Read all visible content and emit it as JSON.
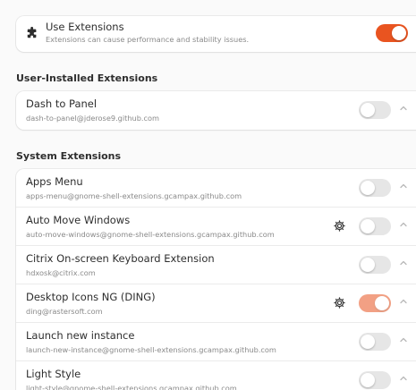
{
  "use_extensions": {
    "title": "Use Extensions",
    "subtitle": "Extensions can cause performance and stability issues.",
    "enabled": true
  },
  "user_installed": {
    "heading": "User-Installed Extensions",
    "items": [
      {
        "name": "Dash to Panel",
        "uuid": "dash-to-panel@jderose9.github.com",
        "enabled": false,
        "has_settings": false
      }
    ]
  },
  "system": {
    "heading": "System Extensions",
    "items": [
      {
        "name": "Apps Menu",
        "uuid": "apps-menu@gnome-shell-extensions.gcampax.github.com",
        "enabled": false,
        "has_settings": false
      },
      {
        "name": "Auto Move Windows",
        "uuid": "auto-move-windows@gnome-shell-extensions.gcampax.github.com",
        "enabled": false,
        "has_settings": true
      },
      {
        "name": "Citrix On-screen Keyboard Extension",
        "uuid": "hdxosk@citrix.com",
        "enabled": false,
        "has_settings": false
      },
      {
        "name": "Desktop Icons NG (DING)",
        "uuid": "ding@rastersoft.com",
        "enabled": true,
        "has_settings": true
      },
      {
        "name": "Launch new instance",
        "uuid": "launch-new-instance@gnome-shell-extensions.gcampax.github.com",
        "enabled": false,
        "has_settings": false
      },
      {
        "name": "Light Style",
        "uuid": "light-style@gnome-shell-extensions.gcampax.github.com",
        "enabled": false,
        "has_settings": false
      }
    ]
  },
  "colors": {
    "accent": "#e95420",
    "background": "#fafafa",
    "card": "#ffffff"
  },
  "icons": {
    "master": "puzzle-icon",
    "settings": "gear-icon",
    "expander": "chevron-up-icon"
  }
}
